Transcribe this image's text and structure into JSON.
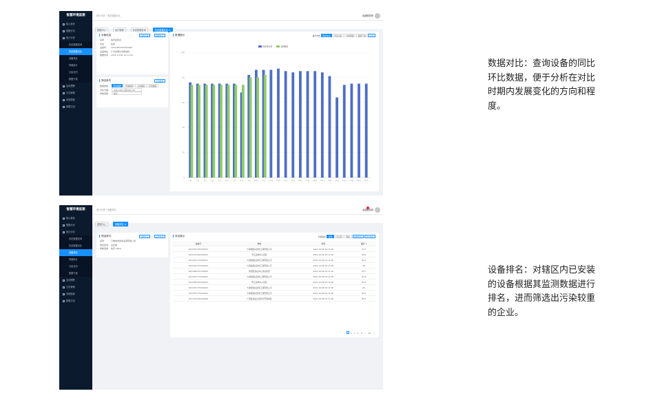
{
  "app": {
    "title": "智慧环境监测"
  },
  "sidebar": {
    "items": [
      {
        "label": "核心看析",
        "type": "main"
      },
      {
        "label": "数据分页",
        "type": "main"
      },
      {
        "label": "统计分析",
        "type": "main"
      },
      {
        "label": "历史数据查询",
        "type": "sub"
      },
      {
        "label": "历史数据对比",
        "type": "sub"
      },
      {
        "label": "设备排名",
        "type": "sub"
      },
      {
        "label": "同期统计",
        "type": "sub"
      },
      {
        "label": "污染日历",
        "type": "sub"
      },
      {
        "label": "数据下载",
        "type": "sub"
      },
      {
        "label": "自动预警",
        "type": "main"
      },
      {
        "label": "日志管理",
        "type": "main"
      },
      {
        "label": "系统配置",
        "type": "main"
      },
      {
        "label": "数据订阅",
        "type": "main"
      }
    ]
  },
  "screen1": {
    "breadcrumb": "统计分析 / 历史数据对比",
    "user": "运营服务商",
    "tabs": [
      "数据中心",
      "运行管理",
      "历史数据查询",
      "历史数据对比 ×"
    ],
    "device_panel": {
      "title": "设备信息",
      "btn1": "选择设备",
      "btn2": "数据检查",
      "rows": [
        {
          "k": "名称",
          "v": "噪声监测点"
        },
        {
          "k": "状态",
          "v": "在线"
        },
        {
          "k": "设备号",
          "v": "2021080100000098"
        },
        {
          "k": "设备地址",
          "v": "广东省惠州市惠城区"
        },
        {
          "k": "数据时间",
          "v": "2021-10-08 10:11:00"
        }
      ]
    },
    "cond_panel": {
      "title": "筛选条件",
      "btn": "查询数据",
      "row1_label": "数据类型",
      "segments": [
        "实时数据",
        "分钟数据",
        "小时数据",
        "日均数据"
      ],
      "row2_label": "对比日期",
      "row2_value": "2021-08-11至2021-10",
      "row3_label": "参数选择",
      "row3_value": "噪声"
    },
    "chart_panel": {
      "title": "数据图示",
      "controls": [
        "显示方式",
        "同比对比",
        "环比对比",
        "分析数据",
        "数据下载",
        "下载"
      ]
    }
  },
  "screen2": {
    "breadcrumb": "统计分析 / 设备排名",
    "user": "运营服务商",
    "tabs": [
      "数据中心",
      "设备排名 ×"
    ],
    "cond_panel": {
      "title": "筛选条件",
      "btn1": "选择企业",
      "btn2": "重置筛选",
      "rows": [
        {
          "k": "名称",
          "v": "万维城市建筑资源有限公司"
        },
        {
          "k": "排名区域",
          "v": "全区域"
        },
        {
          "k": "参数选择",
          "v": "噪声 dB(A)"
        }
      ]
    },
    "table_panel": {
      "title": "排名展示",
      "controls": [
        "分页显示",
        "全部",
        "不分页",
        "导出",
        "数据检查",
        "导出排名"
      ],
      "headers": [
        "设备号",
        "地址",
        "时间",
        "噪声 ↓"
      ],
      "rows": [
        [
          "2021051700109013",
          "大湖镇国兴建筑工程有限公司",
          "2021-10-08 10:11:00",
          "94.3"
        ],
        [
          "2021071450109013",
          "粤江建筑中心项目",
          "2021-10-08 10:11:00",
          "89.6"
        ],
        [
          "2021051770109017",
          "大湖镇国兴建筑工程有限公司",
          "2021-10-08 10:11:00",
          "85.1"
        ],
        [
          "2021051770109012",
          "大湖镇国兴建筑工程有限公司",
          "2021-10-08 10:11:00",
          "84"
        ],
        [
          "2021060107106903",
          "惠阳区建设中心建设项目",
          "2021-10-08 10:11:00",
          "83.7"
        ],
        [
          "2021051770109021",
          "大湖镇国兴建筑工程有限公司",
          "2021-10-08 10:11:00",
          "82.9"
        ],
        [
          "2021082300109011",
          "粤江建筑中心项目",
          "2021-10-08 10:11:00",
          "82.6"
        ],
        [
          "2021051770109023",
          "大湖镇国兴建筑工程有限公司",
          "2021-10-08 10:11:00",
          "82"
        ],
        [
          "2021051770109022",
          "大湖镇国兴建筑工程有限公司",
          "2021-10-08 10:11:00",
          "80.4"
        ],
        [
          "2021051950109060",
          "广西区建设台项目中开展地区",
          "2021-10-08 10:11:00",
          "80.4"
        ]
      ],
      "pager": [
        "‹",
        "1",
        "2",
        "3",
        "4",
        "5",
        "…",
        "10",
        "›"
      ]
    }
  },
  "captions": {
    "compare": "数据对比：查询设备的同比环比数据，便于分析在对比时期内发展变化的方向和程度。",
    "ranking": "设备排名：对辖区内已安装的设备根据其监测数据进行排名，进而筛选出污染较重的企业。"
  },
  "chart_data": {
    "type": "bar",
    "legend": [
      "历史对比值",
      "当前数值"
    ],
    "legend_placement": "top",
    "colors": {
      "current": "#4e6ec4",
      "history": "#8fcb6a"
    },
    "ylim": [
      0,
      100
    ],
    "yticks": [
      0,
      20,
      40,
      60,
      80,
      100
    ],
    "categories": [
      "1日",
      "2日",
      "3日",
      "4日",
      "5日",
      "6日",
      "7日",
      "8日",
      "9日",
      "10日",
      "11日",
      "12日",
      "13日",
      "14日",
      "15日",
      "16日",
      "17日",
      "18日",
      "19日",
      "20日",
      "21日",
      "22日",
      "23日",
      "24日",
      "25日"
    ],
    "series": [
      {
        "name": "当前数值",
        "values": [
          76,
          75,
          75,
          75,
          75,
          75,
          75,
          68,
          82,
          86,
          86,
          86,
          87,
          85,
          84,
          85,
          85,
          85,
          84,
          81,
          64,
          74,
          75,
          75,
          75
        ]
      },
      {
        "name": "历史对比值",
        "values": [
          74,
          74,
          74,
          74,
          74,
          74,
          74,
          74,
          80,
          80,
          82,
          null,
          null,
          null,
          null,
          null,
          null,
          null,
          null,
          null,
          null,
          null,
          null,
          null,
          null
        ]
      }
    ]
  }
}
